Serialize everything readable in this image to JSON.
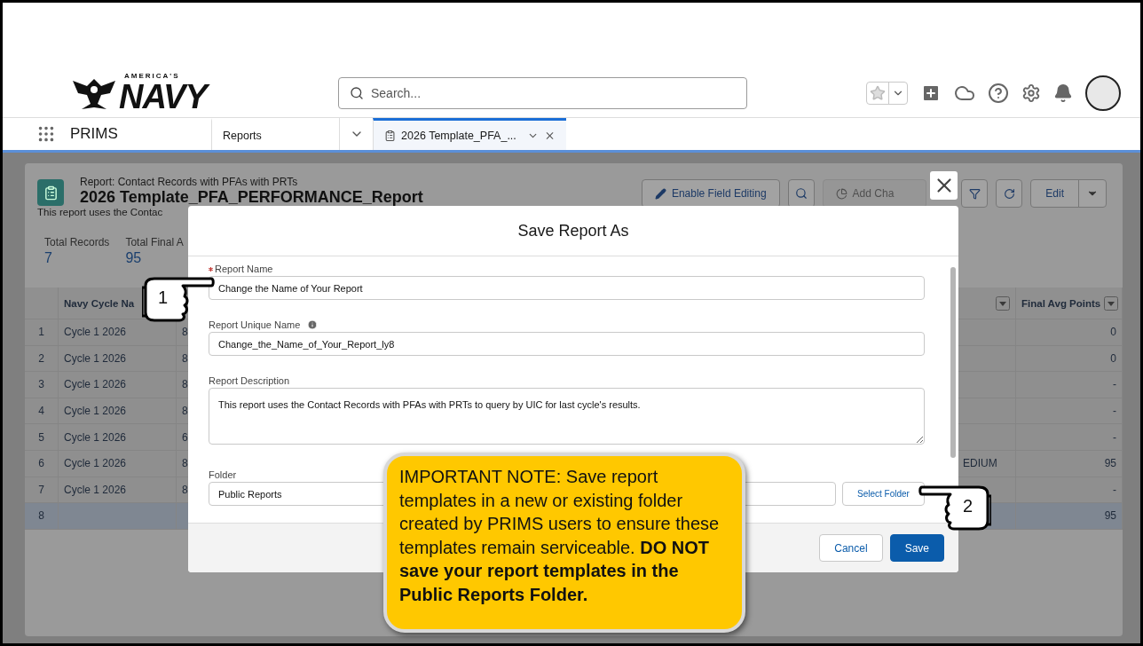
{
  "logo": {
    "tagline": "AMERICA'S",
    "name": "NAVY"
  },
  "search": {
    "placeholder": "Search..."
  },
  "nav": {
    "app_name": "PRIMS",
    "tabs": [
      {
        "label": "Reports",
        "selected": false,
        "kind": "object"
      },
      {
        "label": "2026 Template_PFA_...",
        "selected": true,
        "kind": "record"
      }
    ]
  },
  "report": {
    "subtitle": "Report: Contact Records with PFAs with PRTs",
    "title": "2026 Template_PFA_PERFORMANCE_Report",
    "description": "This report uses the Contac",
    "toolbar": [
      {
        "kind": "pencil",
        "label": "Enable Field Editing",
        "disabled": false
      },
      {
        "kind": "search",
        "disabled": false
      },
      {
        "kind": "chart",
        "label": "Add Cha",
        "disabled": true
      },
      {
        "kind": "filter",
        "disabled": false
      },
      {
        "kind": "refresh",
        "disabled": false
      },
      {
        "kind": "edit",
        "label": "Edit",
        "disabled": false
      }
    ],
    "summary": [
      {
        "label": "Total Records",
        "value": "7"
      },
      {
        "label": "Total Final A",
        "value": "95"
      }
    ]
  },
  "table": {
    "columns": [
      {
        "label": "Navy Cycle Na",
        "menu": false
      },
      {
        "menu": false
      },
      {
        "menu": true
      },
      {
        "label": "Final Avg Points",
        "menu": true
      }
    ],
    "rows": [
      {
        "kind": "record",
        "number": "1",
        "cycle": "Cycle 1 2026",
        "column_3": "8",
        "final_avg": "0"
      },
      {
        "kind": "record",
        "number": "2",
        "cycle": "Cycle 1 2026",
        "column_3": "8",
        "final_avg": "0"
      },
      {
        "kind": "record",
        "number": "3",
        "cycle": "Cycle 1 2026",
        "column_3": "8",
        "final_avg": "-"
      },
      {
        "kind": "record",
        "number": "4",
        "cycle": "Cycle 1 2026",
        "column_3": "8",
        "final_avg": "-"
      },
      {
        "kind": "record",
        "number": "5",
        "cycle": "Cycle 1 2026",
        "column_3": "6",
        "final_avg": "-"
      },
      {
        "kind": "record",
        "number": "6",
        "cycle": "Cycle 1 2026",
        "column_3": "8",
        "column_4": "EDIUM",
        "final_avg": "95"
      },
      {
        "kind": "record",
        "number": "7",
        "cycle": "Cycle 1 2026",
        "column_3": "8",
        "final_avg": "-"
      },
      {
        "kind": "total",
        "number": "8",
        "final_avg": "95"
      }
    ]
  },
  "dialog": {
    "title": "Save Report As",
    "fields": [
      {
        "kind": "input",
        "label": "Report Name",
        "required": true,
        "info": false,
        "value": "Change the Name of Your Report"
      },
      {
        "kind": "input",
        "label": "Report Unique Name",
        "required": false,
        "info": true,
        "value": "Change_the_Name_of_Your_Report_ly8"
      },
      {
        "kind": "textarea",
        "label": "Report Description",
        "required": false,
        "info": false,
        "value": "This report uses the Contact Records with PFAs with PRTs to query by UIC for last cycle's results."
      },
      {
        "kind": "folder",
        "label": "Folder",
        "required": false,
        "info": false,
        "value": "Public Reports",
        "button": "Select Folder"
      }
    ],
    "buttons": [
      {
        "label": "Cancel",
        "kind": "neutral"
      },
      {
        "label": "Save",
        "kind": "brand"
      }
    ]
  },
  "pointers": [
    {
      "number": "1",
      "kind": "right"
    },
    {
      "number": "2",
      "kind": "left"
    }
  ],
  "note": "IMPORTANT NOTE: Save report templates in a new or existing folder created by PRIMS users to ensure these templates remain serviceable. **DO NOT save your report templates in the Public Reports Folder.**"
}
